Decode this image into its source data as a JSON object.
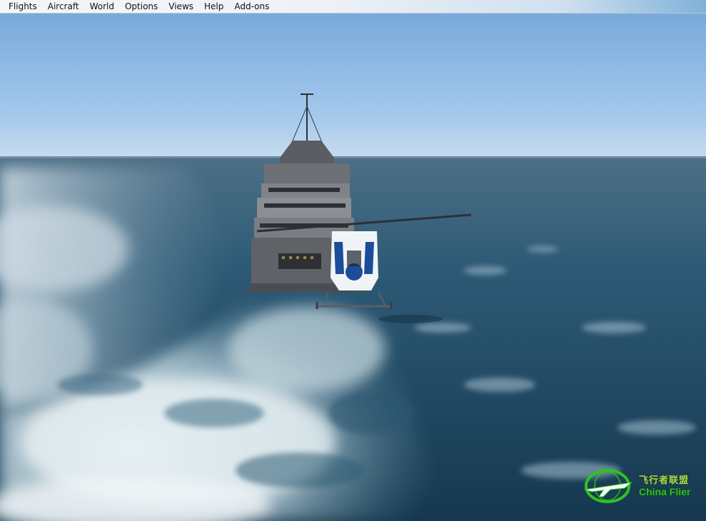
{
  "menubar": {
    "items": [
      {
        "label": "Flights"
      },
      {
        "label": "Aircraft"
      },
      {
        "label": "World"
      },
      {
        "label": "Options"
      },
      {
        "label": "Views"
      },
      {
        "label": "Help"
      },
      {
        "label": "Add-ons"
      }
    ]
  },
  "watermark": {
    "chinese_text": "飞行者联盟",
    "english_text": "China Flier",
    "logo_icon": "globe-airplane-icon",
    "color": "#2fc21f"
  },
  "scene": {
    "sky_color": "#8fbde8",
    "sea_color": "#1f4a66",
    "wake_color": "#dfe9ee",
    "ship_icon": "ship-icon",
    "helicopter_icon": "helicopter-icon"
  }
}
